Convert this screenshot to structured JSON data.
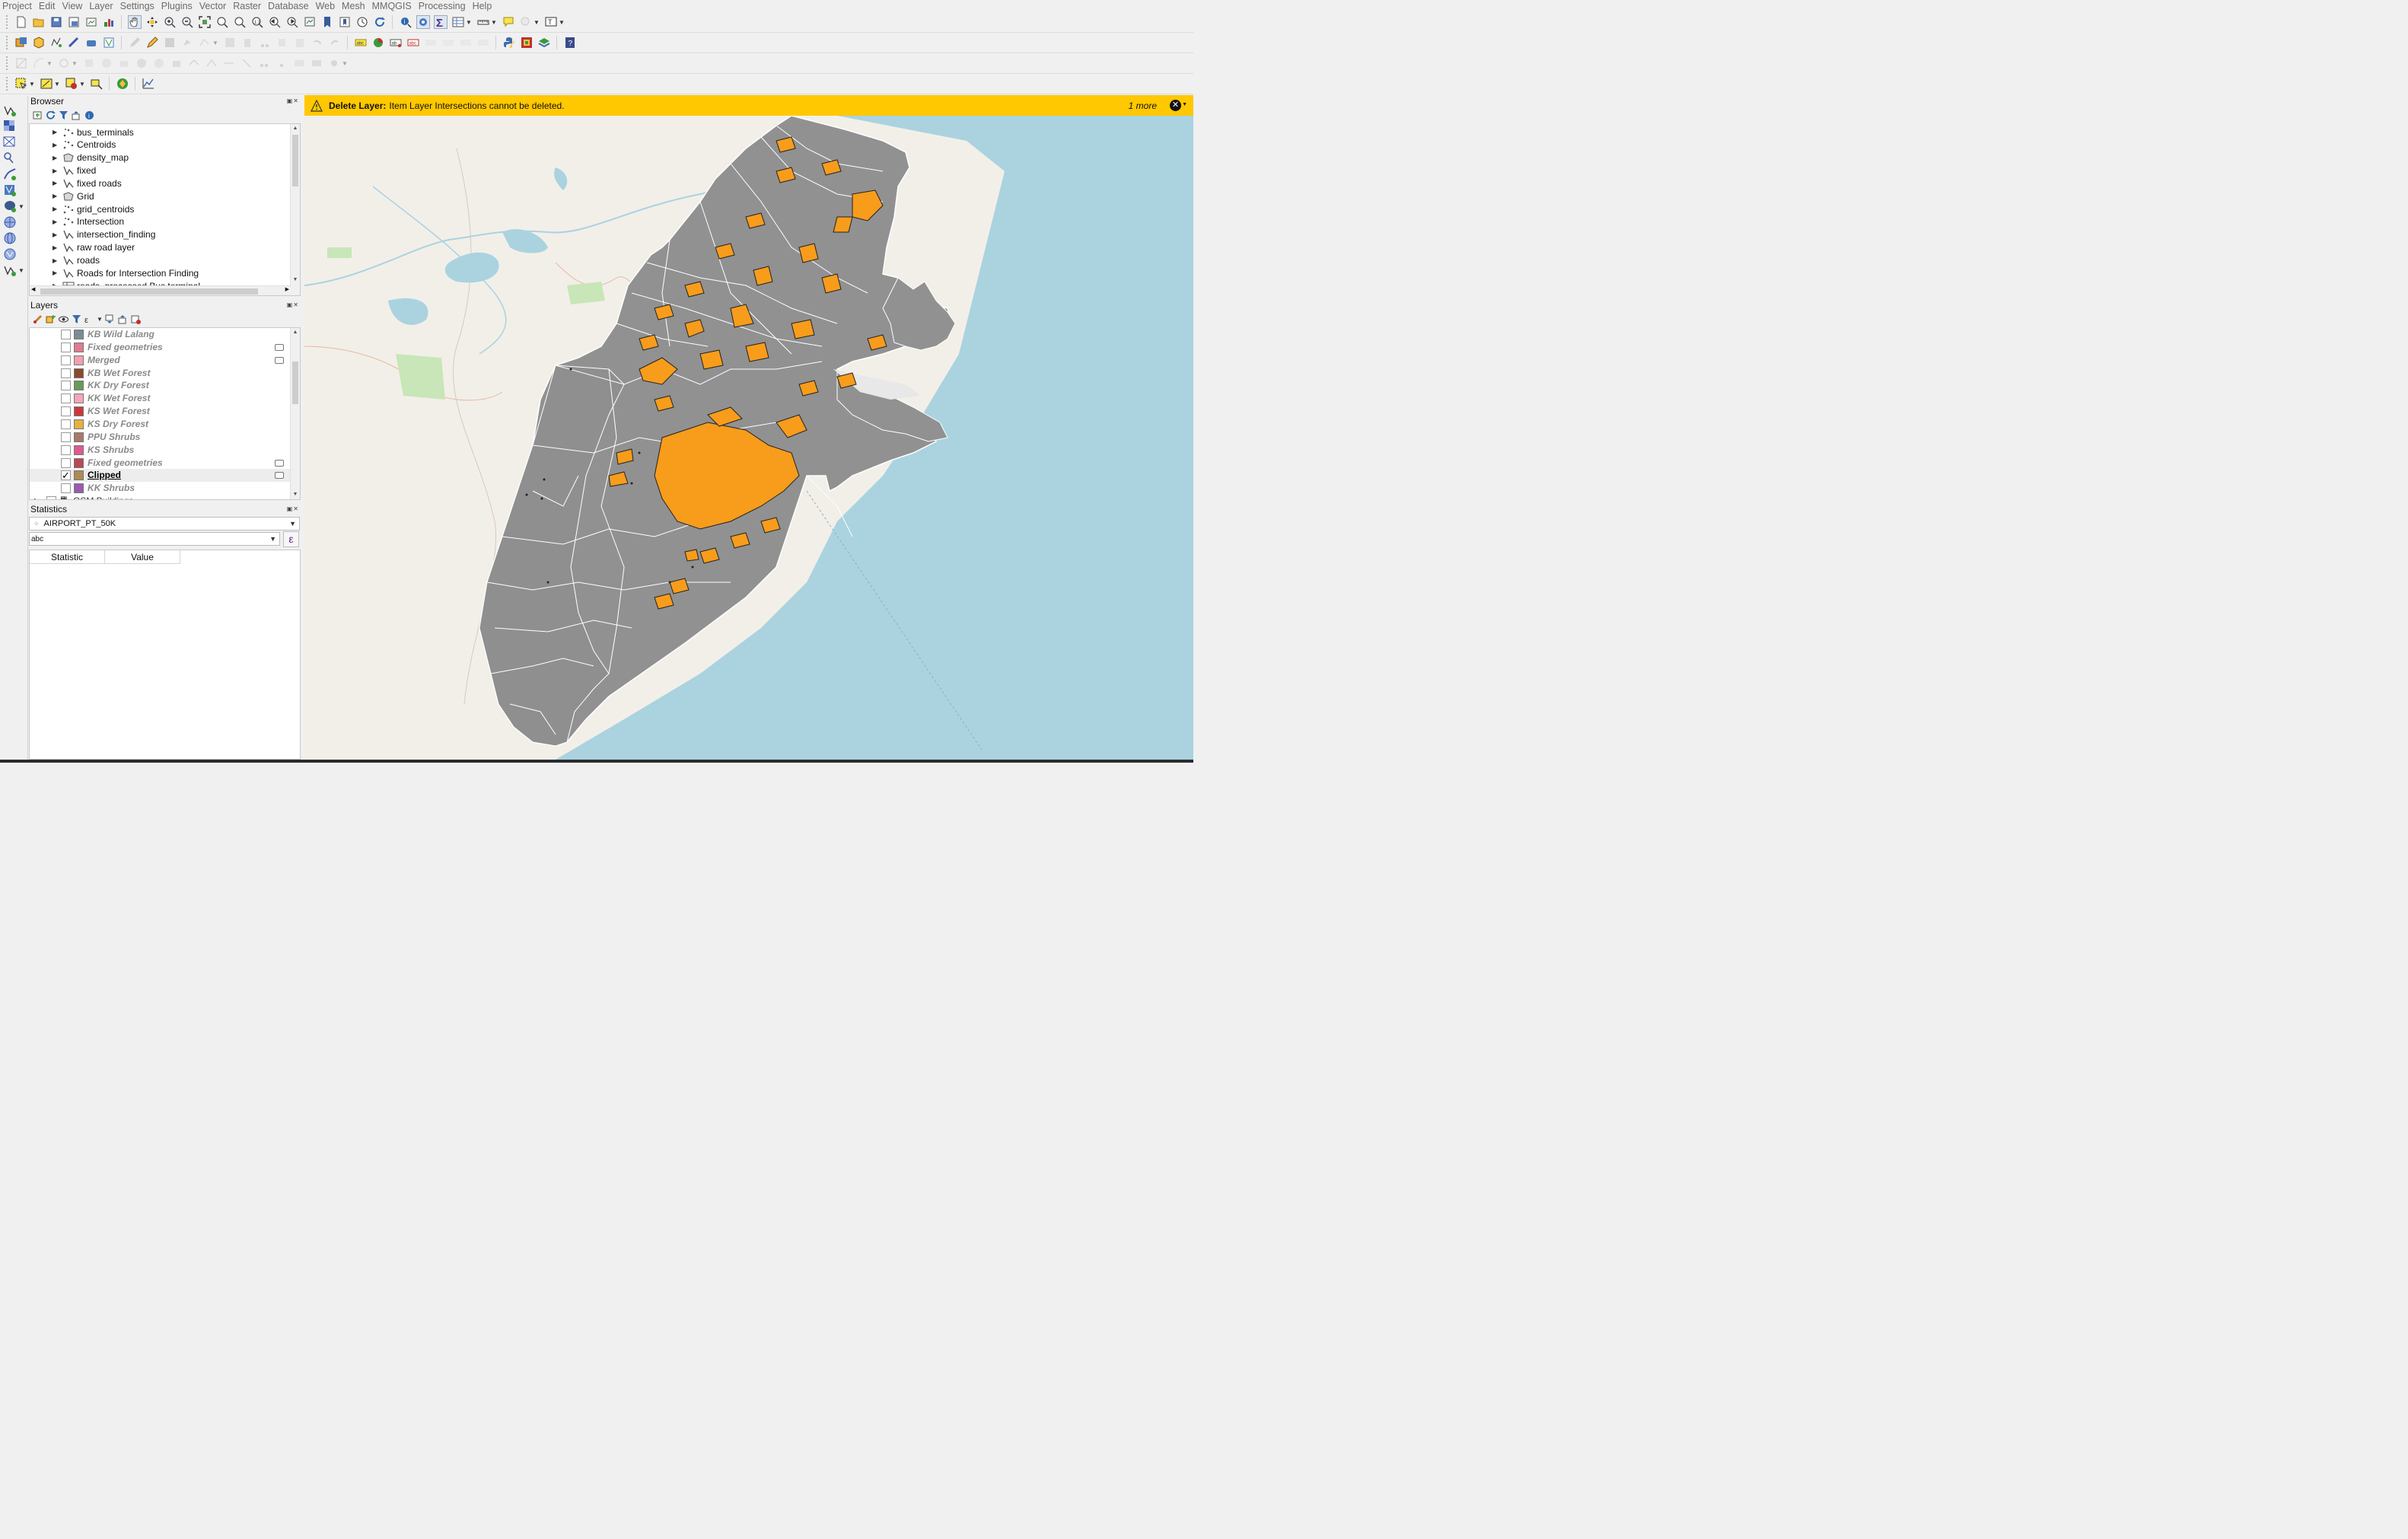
{
  "menubar": {
    "items": [
      "Project",
      "Edit",
      "View",
      "Layer",
      "Settings",
      "Plugins",
      "Vector",
      "Raster",
      "Database",
      "Web",
      "Mesh",
      "MMQGIS",
      "Processing",
      "Help"
    ]
  },
  "browser": {
    "title": "Browser",
    "items": [
      {
        "label": "bus_terminals",
        "icon": "point-layer-icon"
      },
      {
        "label": "Centroids",
        "icon": "point-layer-icon"
      },
      {
        "label": "density_map",
        "icon": "polygon-layer-icon"
      },
      {
        "label": "fixed",
        "icon": "line-layer-icon"
      },
      {
        "label": "fixed roads",
        "icon": "line-layer-icon"
      },
      {
        "label": "Grid",
        "icon": "polygon-layer-icon"
      },
      {
        "label": "grid_centroids",
        "icon": "point-layer-icon"
      },
      {
        "label": "Intersection",
        "icon": "point-layer-icon"
      },
      {
        "label": "intersection_finding",
        "icon": "line-layer-icon"
      },
      {
        "label": "raw road layer",
        "icon": "line-layer-icon"
      },
      {
        "label": "roads",
        "icon": "line-layer-icon"
      },
      {
        "label": "Roads for Intersection Finding",
        "icon": "line-layer-icon"
      },
      {
        "label": "roads_processed Bus terminal",
        "icon": "table-icon"
      }
    ]
  },
  "layers": {
    "title": "Layers",
    "items": [
      {
        "label": "KB Wild Lalang",
        "color": "#7a8c94",
        "checked": false,
        "memory": false,
        "active": false
      },
      {
        "label": "Fixed geometries",
        "color": "#e07a90",
        "checked": false,
        "memory": true,
        "active": false
      },
      {
        "label": "Merged",
        "color": "#f2a0b0",
        "checked": false,
        "memory": true,
        "active": false
      },
      {
        "label": "KB Wet Forest",
        "color": "#8b4a2b",
        "checked": false,
        "memory": false,
        "active": false
      },
      {
        "label": "KK Dry Forest",
        "color": "#6a9a5a",
        "checked": false,
        "memory": false,
        "active": false
      },
      {
        "label": "KK Wet Forest",
        "color": "#f5a6b8",
        "checked": false,
        "memory": false,
        "active": false
      },
      {
        "label": "KS Wet Forest",
        "color": "#c83a3a",
        "checked": false,
        "memory": false,
        "active": false
      },
      {
        "label": "KS Dry Forest",
        "color": "#e8b040",
        "checked": false,
        "memory": false,
        "active": false
      },
      {
        "label": "PPU Shrubs",
        "color": "#a87a6a",
        "checked": false,
        "memory": false,
        "active": false
      },
      {
        "label": "KS Shrubs",
        "color": "#e05a90",
        "checked": false,
        "memory": false,
        "active": false
      },
      {
        "label": "Fixed geometries",
        "color": "#b84a55",
        "checked": false,
        "memory": true,
        "active": false
      },
      {
        "label": "Clipped",
        "color": "#b08a50",
        "checked": true,
        "memory": true,
        "active": true
      },
      {
        "label": "KK Shrubs",
        "color": "#9a5ab0",
        "checked": false,
        "memory": false,
        "active": false
      },
      {
        "label": "OSM Buildings",
        "color": "#888888",
        "checked": false,
        "memory": false,
        "active": false
      }
    ]
  },
  "statistics": {
    "title": "Statistics",
    "layer": "AIRPORT_PT_50K",
    "field": "abc",
    "columns": [
      "Statistic",
      "Value"
    ]
  },
  "message": {
    "title": "Delete Layer:",
    "text": "Item Layer Intersections cannot be deleted.",
    "more": "1 more"
  },
  "colors": {
    "warning_bar": "#ffc800",
    "sea": "#aad3df",
    "land_base": "#f2efe9",
    "region_fill": "#919191",
    "forest_fill": "#f89c1c",
    "region_outline": "#ffffff"
  }
}
